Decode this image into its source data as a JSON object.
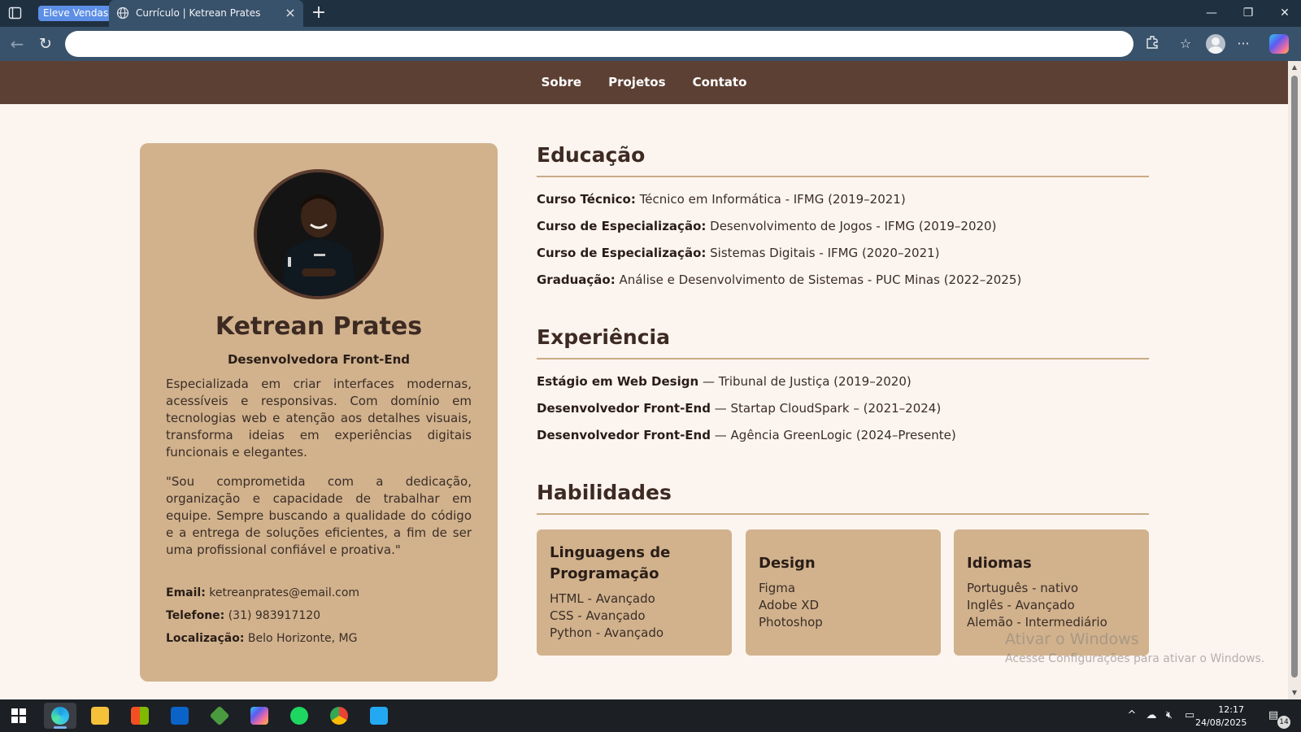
{
  "browser": {
    "tab_group_label": "Eleve Vendas",
    "active_tab_title": "Currículo | Ketrean Prates",
    "address_value": "",
    "window_controls": {
      "minimize": "—",
      "restore": "❐",
      "close": "✕"
    }
  },
  "site": {
    "nav": [
      "Sobre",
      "Projetos",
      "Contato"
    ],
    "profile": {
      "name": "Ketrean Prates",
      "role": "Desenvolvedora Front-End",
      "bio": "Especializada em criar interfaces modernas, acessíveis e responsivas. Com domínio em tecnologias web e atenção aos detalhes visuais, transforma ideias em experiências digitais funcionais e elegantes.",
      "quote": "\"Sou comprometida com a dedicação, organização e capacidade de trabalhar em equipe. Sempre buscando a qualidade do código e a entrega de soluções eficientes, a fim de ser uma profissional confiável e proativa.\"",
      "contact": [
        {
          "label": "Email:",
          "value": "ketreanprates@email.com"
        },
        {
          "label": "Telefone:",
          "value": "(31) 983917120"
        },
        {
          "label": "Localização:",
          "value": "Belo Horizonte, MG"
        }
      ]
    },
    "education": {
      "title": "Educação",
      "items": [
        {
          "label": "Curso Técnico:",
          "value": "Técnico em Informática - IFMG (2019–2021)"
        },
        {
          "label": "Curso de Especialização:",
          "value": "Desenvolvimento de Jogos - IFMG (2019–2020)"
        },
        {
          "label": "Curso de Especialização:",
          "value": "Sistemas Digitais - IFMG (2020–2021)"
        },
        {
          "label": "Graduação:",
          "value": "Análise e Desenvolvimento de Sistemas - PUC Minas (2022–2025)"
        }
      ]
    },
    "experience": {
      "title": "Experiência",
      "items": [
        {
          "label": "Estágio em Web Design",
          "value": "— Tribunal de Justiça (2019–2020)"
        },
        {
          "label": "Desenvolvedor Front-End",
          "value": "— Startap CloudSpark – (2021–2024)"
        },
        {
          "label": "Desenvolvedor Front-End",
          "value": "— Agência GreenLogic (2024–Presente)"
        }
      ]
    },
    "skills": {
      "title": "Habilidades",
      "cards": [
        {
          "title_line1": "Linguagens de",
          "title_line2": "Programação",
          "items": [
            "HTML - Avançado",
            "CSS - Avançado",
            "Python - Avançado"
          ]
        },
        {
          "title_line1": "Design",
          "title_line2": "",
          "items": [
            "Figma",
            "Adobe XD",
            "Photoshop"
          ]
        },
        {
          "title_line1": "Idiomas",
          "title_line2": "",
          "items": [
            "Português - nativo",
            "Inglês - Avançado",
            "Alemão - Intermediário"
          ]
        }
      ]
    }
  },
  "os": {
    "watermark_title": "Ativar o Windows",
    "watermark_sub": "Acesse Configurações para ativar o Windows.",
    "time": "12:17",
    "date": "24/08/2025",
    "notification_count": "14",
    "taskbar_apps": [
      "edge-icon",
      "file-explorer-icon",
      "store-icon",
      "outlook-icon",
      "node-icon",
      "copilot-icon",
      "spotify-icon",
      "chrome-icon",
      "vscode-icon"
    ]
  },
  "colors": {
    "nav_bg": "#5d4034",
    "card_bg": "#d1b28d",
    "page_bg": "#fcf4ef",
    "heading": "#3d2a22"
  }
}
